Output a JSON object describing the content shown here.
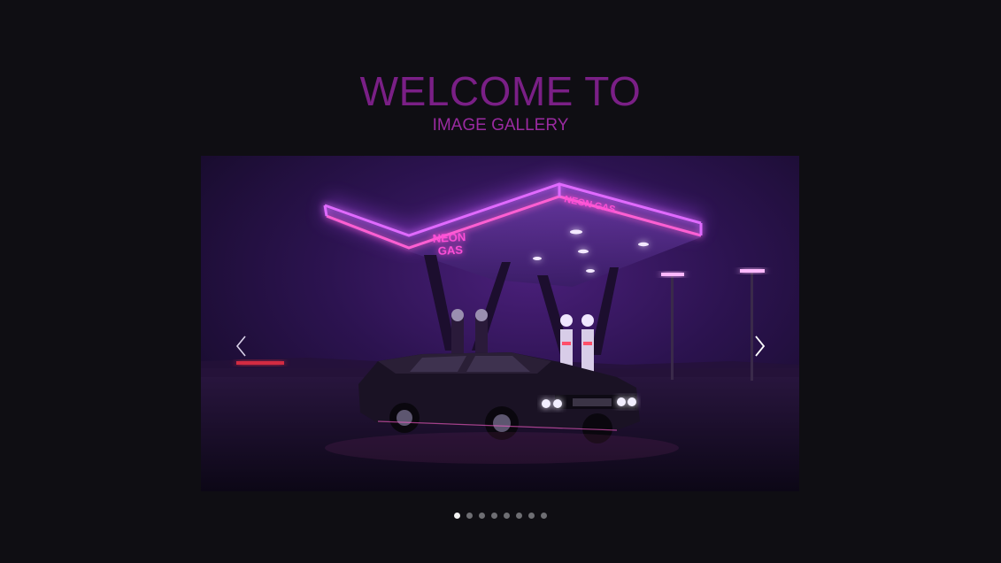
{
  "header": {
    "title": "WELCOME TO",
    "subtitle": "IMAGE GALLERY"
  },
  "slider": {
    "image_description_icon": "neon-gas-station-photo",
    "sign_text": "NEON GAS",
    "canopy_text": "NEON GAS",
    "prev_icon": "chevron-left-icon",
    "next_icon": "chevron-right-icon",
    "slide_count": 8,
    "active_index": 0
  },
  "colors": {
    "background": "#0f0e13",
    "title": "#7a1f86",
    "accent_neon": "#b040ff",
    "dot_active": "#f2f2f2",
    "dot_inactive": "#6e6e73"
  }
}
